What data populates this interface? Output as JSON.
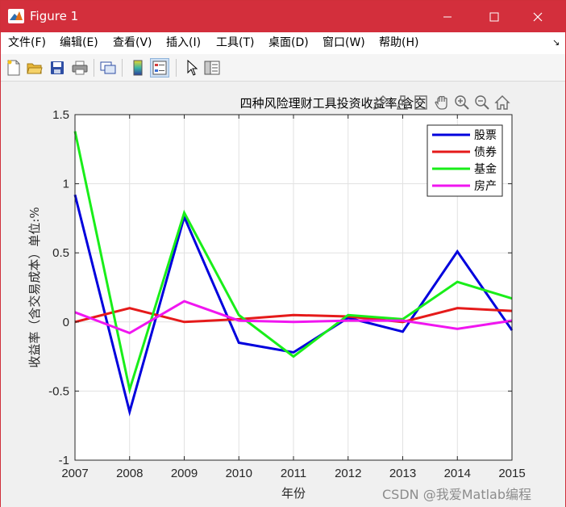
{
  "window": {
    "title": "Figure 1",
    "accent": "#d32f3c"
  },
  "menubar": {
    "items": [
      "文件(F)",
      "编辑(E)",
      "查看(V)",
      "插入(I)",
      "工具(T)",
      "桌面(D)",
      "窗口(W)",
      "帮助(H)"
    ],
    "overflow": "↘"
  },
  "toolbar": {
    "icons": [
      "new-figure-icon",
      "open-file-icon",
      "save-icon",
      "print-icon",
      "link-plot-icon",
      "insert-colorbar-icon",
      "insert-legend-icon",
      "edit-plot-icon",
      "property-inspector-icon"
    ]
  },
  "axes_toolbar": {
    "icons": [
      "brush-icon",
      "data-tips-icon",
      "zoom-region-icon",
      "pan-icon",
      "zoom-in-icon",
      "zoom-out-icon",
      "restore-view-icon"
    ]
  },
  "chart_data": {
    "type": "line",
    "title": "四种风险理财工具投资收益率(含交",
    "xlabel": "年份",
    "ylabel": "收益率（含交易成本）单位:%",
    "x": [
      2007,
      2008,
      2009,
      2010,
      2011,
      2012,
      2013,
      2014,
      2015
    ],
    "xlim": [
      2007,
      2015
    ],
    "ylim": [
      -1,
      1.5
    ],
    "xticks": [
      "2007",
      "2008",
      "2009",
      "2010",
      "2011",
      "2012",
      "2013",
      "2014",
      "2015"
    ],
    "yticks": [
      "1.5",
      "1",
      "0.5",
      "0",
      "-0.5",
      "-1"
    ],
    "grid": true,
    "legend_position": "top-right",
    "series": [
      {
        "name": "股票",
        "color": "#0000dd",
        "values": [
          0.92,
          -0.65,
          0.76,
          -0.15,
          -0.22,
          0.03,
          -0.07,
          0.51,
          -0.06
        ]
      },
      {
        "name": "债券",
        "color": "#e51a1a",
        "values": [
          0.0,
          0.1,
          0.0,
          0.02,
          0.05,
          0.04,
          0.0,
          0.1,
          0.08
        ]
      },
      {
        "name": "基金",
        "color": "#19ee19",
        "values": [
          1.38,
          -0.49,
          0.79,
          0.05,
          -0.25,
          0.05,
          0.02,
          0.29,
          0.17
        ]
      },
      {
        "name": "房产",
        "color": "#f016f0",
        "values": [
          0.07,
          -0.08,
          0.15,
          0.01,
          0.0,
          0.01,
          0.01,
          -0.05,
          0.01
        ]
      }
    ]
  },
  "watermark": "CSDN @我爱Matlab编程"
}
